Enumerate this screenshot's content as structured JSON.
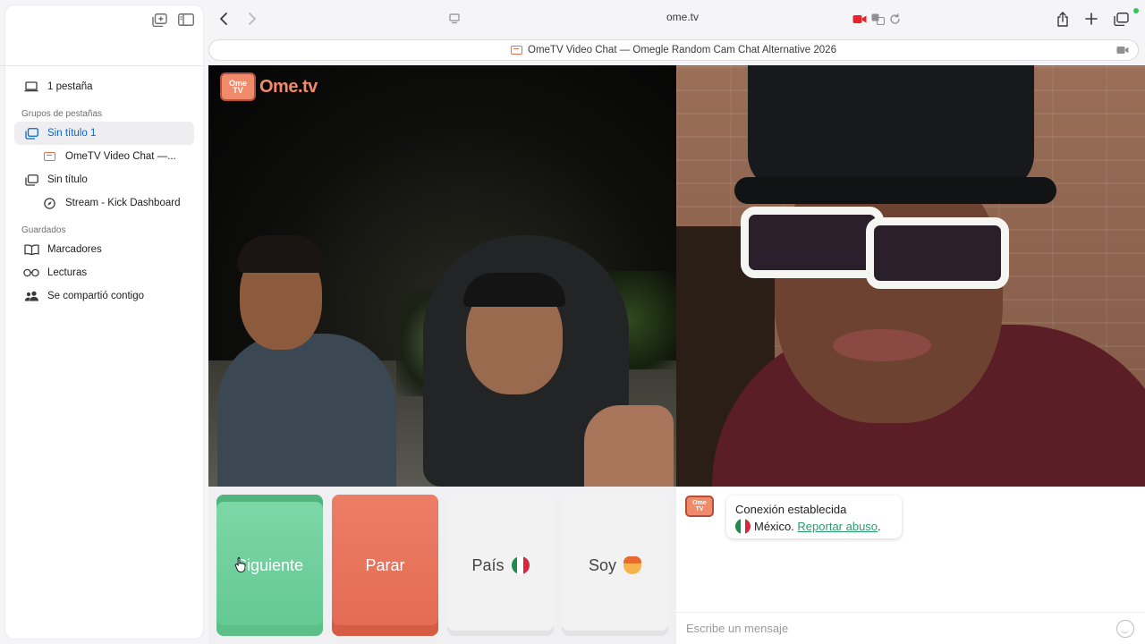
{
  "sidebar": {
    "tabs_count_label": "1 pestaña",
    "tab_groups_heading": "Grupos de pestañas",
    "items": [
      {
        "label": "Sin título 1",
        "icon": "tab-group-icon",
        "active": true
      },
      {
        "label": "OmeTV Video Chat —...",
        "icon": "ometv-favicon"
      },
      {
        "label": "Sin título",
        "icon": "tab-group-icon"
      },
      {
        "label": "Stream - Kick Dashboard",
        "icon": "compass-icon"
      }
    ],
    "saved_heading": "Guardados",
    "saved": [
      {
        "label": "Marcadores",
        "icon": "book-icon"
      },
      {
        "label": "Lecturas",
        "icon": "glasses-icon"
      },
      {
        "label": "Se compartió contigo",
        "icon": "shared-people-icon"
      }
    ]
  },
  "toolbar": {
    "url": "ome.tv"
  },
  "tab": {
    "title": "OmeTV Video Chat — Omegle Random Cam Chat Alternative 2026"
  },
  "logo": {
    "badge_line1": "Ome",
    "badge_line2": "TV",
    "text": "Ome.tv"
  },
  "controls": {
    "next": "Siguiente",
    "stop": "Parar",
    "country": "País",
    "me": "Soy"
  },
  "chat": {
    "status_line": "Conexión establecida",
    "country": "México.",
    "report_link": "Reportar abuso",
    "report_suffix": ".",
    "input_placeholder": "Escribe un mensaje"
  },
  "colors": {
    "next_button": "#6fd09c",
    "stop_button": "#e8735b",
    "accent_link": "#2b9c6b",
    "sidebar_active": "#0a64d8"
  }
}
